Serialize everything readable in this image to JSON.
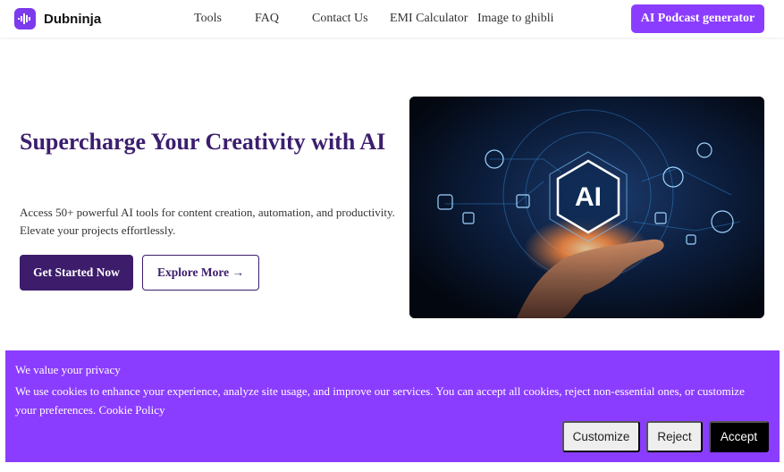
{
  "brand": {
    "name": "Dubninja",
    "accent": "#8b3dff",
    "logo_icon": "waveform-icon"
  },
  "nav": {
    "items": [
      "Tools",
      "FAQ",
      "Contact Us",
      "EMI Calculator",
      "Image to ghibli"
    ],
    "cta": "AI Podcast generator"
  },
  "hero": {
    "title": "Supercharge Your Creativity with AI",
    "description": "Access 50+ powerful AI tools for content creation, automation, and productivity. Elevate your projects effortlessly.",
    "primary_button": "Get Started Now",
    "secondary_button": "Explore More →",
    "image_label": "AI",
    "title_color": "#3b1e6e"
  },
  "cookie": {
    "title": "We value your privacy",
    "text": "We use cookies to enhance your experience, analyze site usage, and improve our services. You can accept all cookies, reject non-essential ones, or customize your preferences.",
    "link": "Cookie Policy",
    "customize": "Customize",
    "reject": "Reject",
    "accept": "Accept",
    "background": "#8b3dff"
  }
}
